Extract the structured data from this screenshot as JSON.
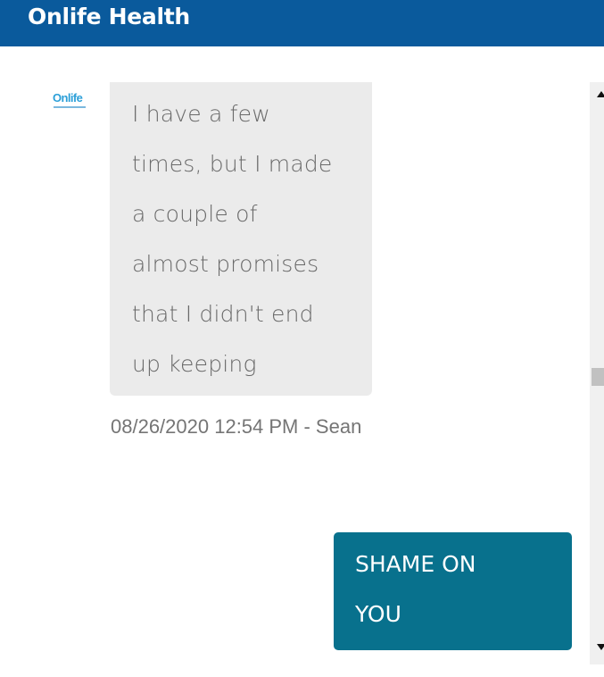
{
  "header": {
    "title": "Onlife Health"
  },
  "avatar": {
    "logo_text": "Onlife"
  },
  "messages": [
    {
      "direction": "incoming",
      "text": "I have a few\ntimes, but I made\na couple of\nalmost promises\nthat I didn't end\nup keeping",
      "meta": "08/26/2020 12:54 PM - Sean"
    },
    {
      "direction": "outgoing",
      "text": "SHAME ON\nYOU"
    }
  ],
  "colors": {
    "header_bg": "#0a5a9c",
    "incoming_bubble": "#ebebeb",
    "outgoing_bubble": "#08718d"
  },
  "icons": {
    "scroll_up": "triangle-up-icon",
    "scroll_down": "triangle-down-icon"
  }
}
